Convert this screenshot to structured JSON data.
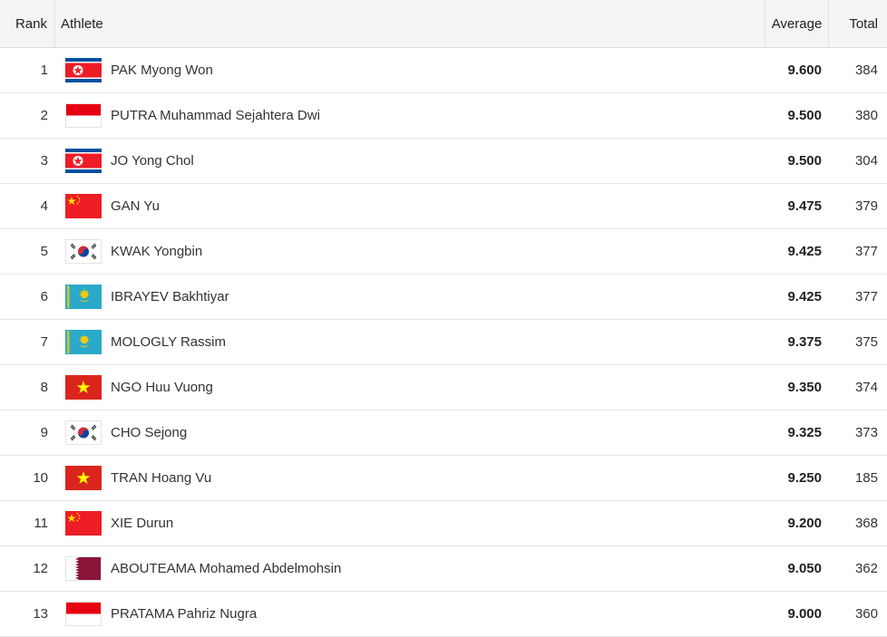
{
  "header": {
    "rank": "Rank",
    "athlete": "Athlete",
    "average": "Average",
    "total": "Total"
  },
  "rows": [
    {
      "rank": "1",
      "flag": "north-korea-flag-icon",
      "name": "PAK Myong Won",
      "average": "9.600",
      "total": "384"
    },
    {
      "rank": "2",
      "flag": "indonesia-flag-icon",
      "name": "PUTRA Muhammad Sejahtera Dwi",
      "average": "9.500",
      "total": "380"
    },
    {
      "rank": "3",
      "flag": "north-korea-flag-icon",
      "name": "JO Yong Chol",
      "average": "9.500",
      "total": "304"
    },
    {
      "rank": "4",
      "flag": "china-flag-icon",
      "name": "GAN Yu",
      "average": "9.475",
      "total": "379"
    },
    {
      "rank": "5",
      "flag": "south-korea-flag-icon",
      "name": "KWAK Yongbin",
      "average": "9.425",
      "total": "377"
    },
    {
      "rank": "6",
      "flag": "kazakhstan-flag-icon",
      "name": "IBRAYEV Bakhtiyar",
      "average": "9.425",
      "total": "377"
    },
    {
      "rank": "7",
      "flag": "kazakhstan-flag-icon",
      "name": "MOLOGLY Rassim",
      "average": "9.375",
      "total": "375"
    },
    {
      "rank": "8",
      "flag": "vietnam-flag-icon",
      "name": "NGO Huu Vuong",
      "average": "9.350",
      "total": "374"
    },
    {
      "rank": "9",
      "flag": "south-korea-flag-icon",
      "name": "CHO Sejong",
      "average": "9.325",
      "total": "373"
    },
    {
      "rank": "10",
      "flag": "vietnam-flag-icon",
      "name": "TRAN Hoang Vu",
      "average": "9.250",
      "total": "185"
    },
    {
      "rank": "11",
      "flag": "china-flag-icon",
      "name": "XIE Durun",
      "average": "9.200",
      "total": "368"
    },
    {
      "rank": "12",
      "flag": "qatar-flag-icon",
      "name": "ABOUTEAMA Mohamed Abdelmohsin",
      "average": "9.050",
      "total": "362"
    },
    {
      "rank": "13",
      "flag": "indonesia-flag-icon",
      "name": "PRATAMA Pahriz Nugra",
      "average": "9.000",
      "total": "360"
    }
  ]
}
